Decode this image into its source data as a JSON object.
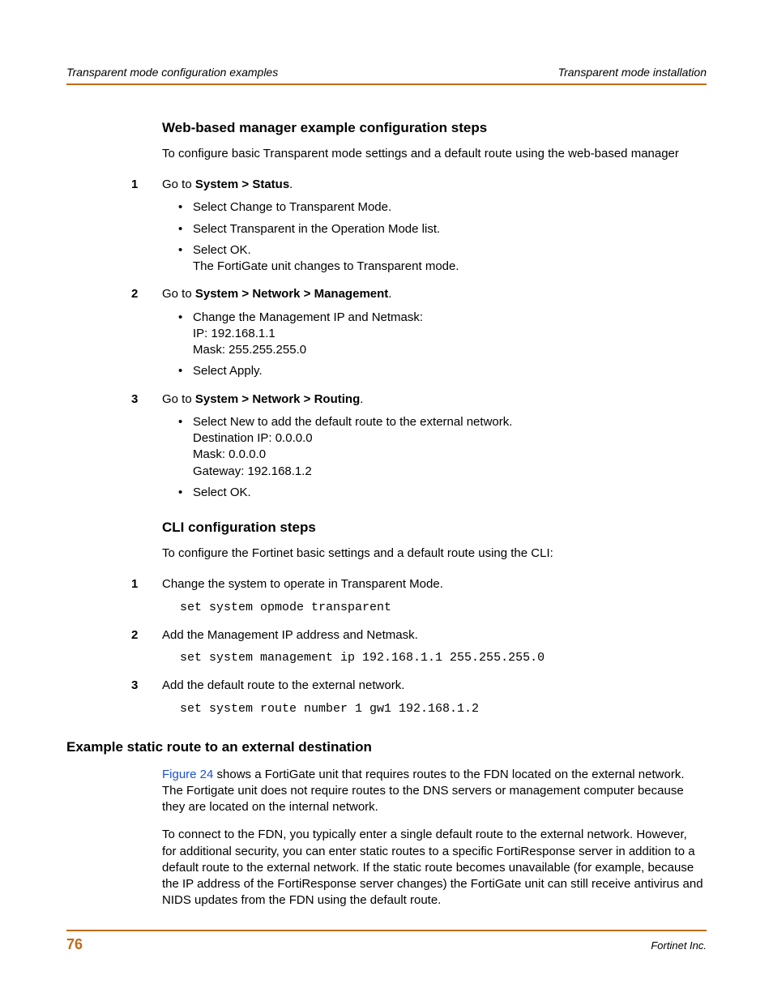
{
  "header": {
    "left": "Transparent mode configuration examples",
    "right": "Transparent mode installation"
  },
  "section1": {
    "title": "Web-based manager example configuration steps",
    "intro": "To configure basic Transparent mode settings and a default route using the web-based manager",
    "steps": [
      {
        "num": "1",
        "prefix": "Go to ",
        "bold": "System > Status",
        "suffix": ".",
        "bullets": [
          {
            "text": "Select Change to Transparent Mode."
          },
          {
            "text": "Select Transparent in the Operation Mode list."
          },
          {
            "text": "Select OK.",
            "extra": [
              "The FortiGate unit changes to Transparent mode."
            ]
          }
        ]
      },
      {
        "num": "2",
        "prefix": "Go to ",
        "bold": "System > Network > Management",
        "suffix": ".",
        "bullets": [
          {
            "text": "Change the Management IP and Netmask:",
            "extra": [
              "IP: 192.168.1.1",
              "Mask: 255.255.255.0"
            ]
          },
          {
            "text": "Select Apply."
          }
        ]
      },
      {
        "num": "3",
        "prefix": "Go to ",
        "bold": "System > Network > Routing",
        "suffix": ".",
        "bullets": [
          {
            "text": "Select New to add the default route to the external network.",
            "extra": [
              "Destination IP: 0.0.0.0",
              "Mask: 0.0.0.0",
              "Gateway: 192.168.1.2"
            ]
          },
          {
            "text": "Select OK."
          }
        ]
      }
    ]
  },
  "section2": {
    "title": "CLI configuration steps",
    "intro": "To configure the Fortinet basic settings and a default route using the CLI:",
    "steps": [
      {
        "num": "1",
        "text": "Change the system to operate in Transparent Mode.",
        "code": "set system opmode transparent"
      },
      {
        "num": "2",
        "text": "Add the Management IP address and Netmask.",
        "code": "set system management ip 192.168.1.1 255.255.255.0"
      },
      {
        "num": "3",
        "text": "Add the default route to the external network.",
        "code": "set system route number 1 gw1 192.168.1.2"
      }
    ]
  },
  "section3": {
    "title": "Example static route to an external destination",
    "figref": "Figure 24",
    "para1_rest": " shows a FortiGate unit that requires routes to the FDN located on the external network. The Fortigate unit does not require routes to the DNS servers or management computer because they are located on the internal network.",
    "para2": "To connect to the FDN, you typically enter a single default route to the external network. However, for additional security, you can enter static routes to a specific FortiResponse server in addition to a default route to the external network. If the static route becomes unavailable (for example, because the IP address of the FortiResponse server changes) the FortiGate unit can still receive antivirus and NIDS updates from the FDN using the default route."
  },
  "footer": {
    "page": "76",
    "company": "Fortinet Inc."
  }
}
